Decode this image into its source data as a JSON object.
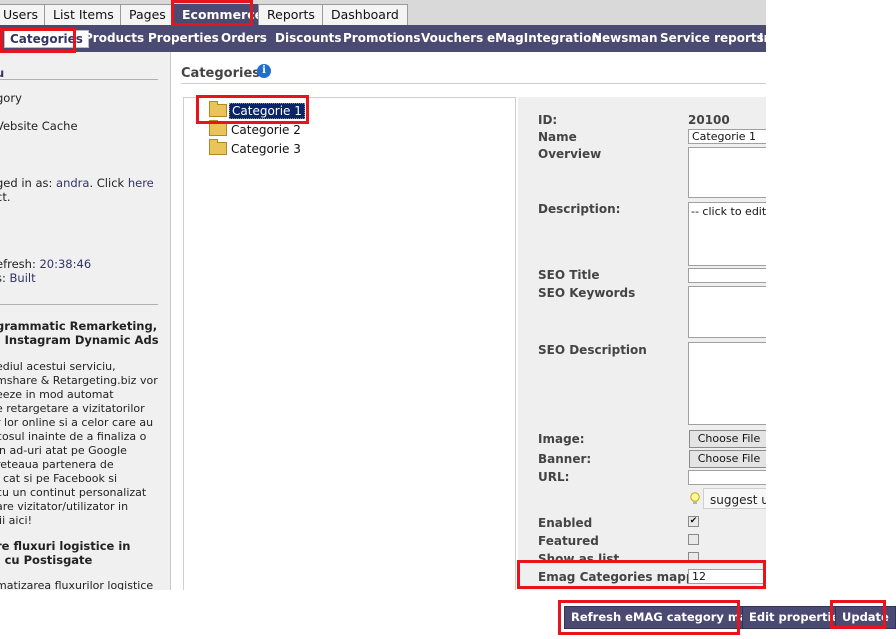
{
  "tabs": [
    {
      "label": "Users",
      "active": false
    },
    {
      "label": "List Items",
      "active": false
    },
    {
      "label": "Pages",
      "active": false
    },
    {
      "label": "Ecommerce",
      "active": true
    },
    {
      "label": "Reports",
      "active": false
    },
    {
      "label": "Dashboard",
      "active": false
    }
  ],
  "subnav": [
    {
      "label": "Categories",
      "active": true
    },
    {
      "label": "Products",
      "active": false
    },
    {
      "label": "Properties",
      "active": false
    },
    {
      "label": "Orders",
      "active": false
    },
    {
      "label": "Discounts",
      "active": false
    },
    {
      "label": "Promotions",
      "active": false
    },
    {
      "label": "Vouchers",
      "active": false
    },
    {
      "label": "eMagIntegration",
      "active": false
    },
    {
      "label": "Newsman",
      "active": false
    },
    {
      "label": "Service reports",
      "active": false
    },
    {
      "label": "In",
      "active": false
    }
  ],
  "sidebar": {
    "header_fragment": "u",
    "category_fragment": "gory",
    "website_cache": "Vebsite Cache",
    "logged_prefix": "ged in as: ",
    "logged_user": "andra",
    "logged_suffix": ". Click ",
    "here_link": "here",
    "logged_line2": "ct.",
    "refresh_label": "efresh: ",
    "refresh_time": "20:38:46",
    "status_label": "s: ",
    "status_value": "Built",
    "news1_title_1": "grammatic Remarketing,",
    "news1_title_2": ": Instagram Dynamic Ads",
    "news1_body": [
      "ediul acestui serviciu,",
      "mshare & Retargeting.biz vor",
      "eeze in mod automat",
      "e retargetare a vizitatorilor",
      "r lor online si a celor care au",
      "cosul inainte de a finaliza o",
      "in ad-uri atat pe Google",
      "reteaua partenera de",
      ", cat si pe Facebook si",
      "cu un continut personalizat",
      "are vizitator/utilizator in",
      "lii aici!"
    ],
    "news2_title_1": "re fluxuri logistice in",
    "news2_title_2": ": cu Postisgate",
    "news2_body": "matizarea fluxurilor logistice"
  },
  "main": {
    "title": "Categories",
    "info_icon": "info-icon"
  },
  "tree": {
    "items": [
      {
        "label": "Categorie 1",
        "selected": true
      },
      {
        "label": "Categorie 2",
        "selected": false
      },
      {
        "label": "Categorie 3",
        "selected": false
      }
    ]
  },
  "form": {
    "id_label": "ID:",
    "id_value": "20100",
    "name_label": "Name",
    "name_value": "Categorie 1",
    "overview_label": "Overview",
    "overview_value": "",
    "description_label": "Description:",
    "description_value": "-- click to edit",
    "seo_title_label": "SEO Title",
    "seo_title_value": "",
    "seo_keywords_label": "SEO Keywords",
    "seo_keywords_value": "",
    "seo_description_label": "SEO Description",
    "seo_description_value": "",
    "image_label": "Image:",
    "banner_label": "Banner:",
    "choose_file": "Choose File",
    "url_label": "URL:",
    "url_value": "",
    "suggest_text": "suggest ur",
    "enabled_label": "Enabled",
    "enabled_checked": true,
    "featured_label": "Featured",
    "featured_checked": false,
    "show_as_list_label": "Show as list",
    "show_as_list_checked": false,
    "emag_mapping_label": "Emag Categories mapping",
    "emag_mapping_value": "12",
    "check_mark": "✔"
  },
  "buttons": {
    "refresh_emag": "Refresh eMAG category mapping",
    "edit_properties": "Edit properties",
    "update": "Update"
  },
  "colors": {
    "nav_bg": "#4a4a72",
    "highlight": "#e8141b",
    "selected_bg": "#0a246a"
  }
}
